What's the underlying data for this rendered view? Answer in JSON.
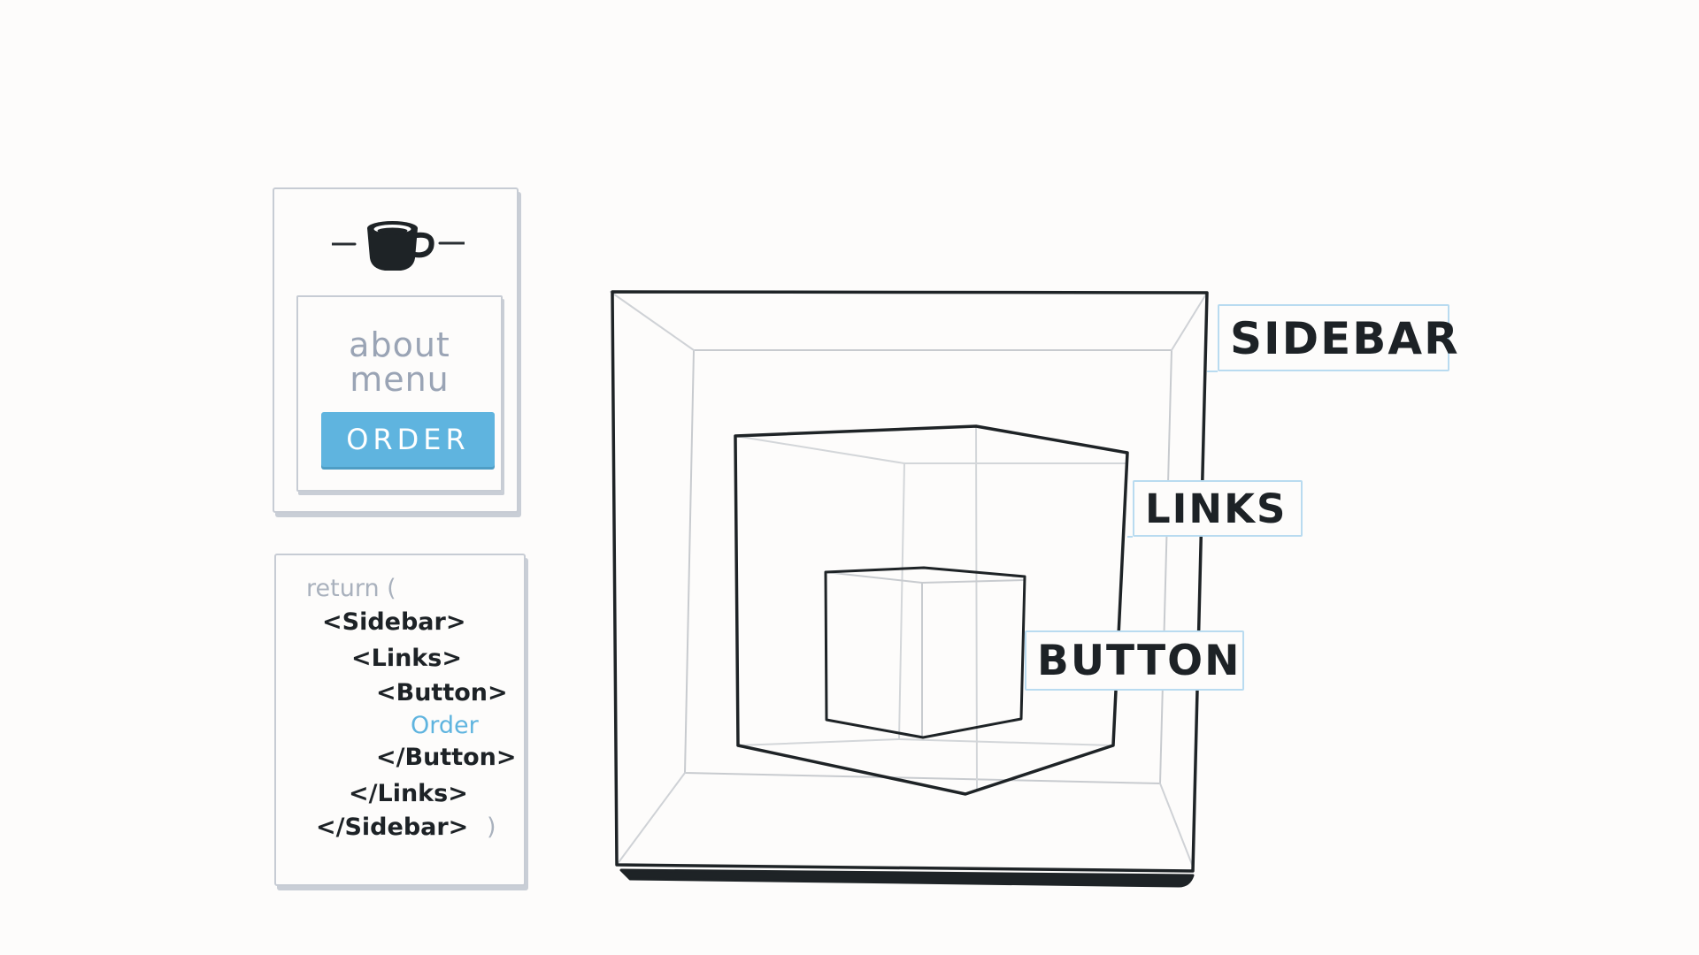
{
  "ui_mockup": {
    "icon": "coffee-cup-icon",
    "nav_links": [
      "about",
      "menu"
    ],
    "order_button": "ORDER",
    "accent_color": "#5fb4df"
  },
  "code": {
    "lines": [
      "return (",
      "<Sidebar>",
      "<Links>",
      "<Button>",
      "Order",
      "</Button>",
      "</Links>",
      "</Sidebar>",
      ")"
    ]
  },
  "diagram": {
    "labels": {
      "sidebar": "SIDEBAR",
      "links": "LINKS",
      "button": "BUTTON"
    },
    "label_border_color": "#b9dbf0"
  }
}
